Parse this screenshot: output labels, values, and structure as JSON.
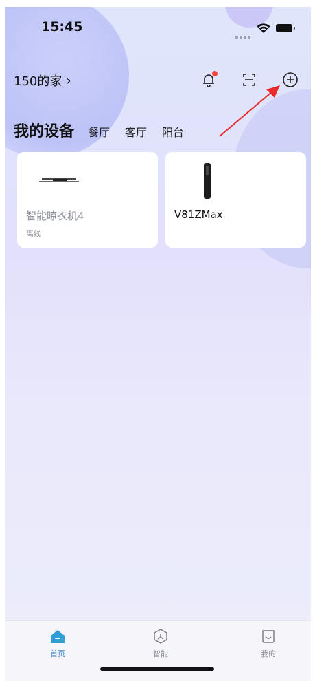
{
  "status_bar": {
    "time": "15:45"
  },
  "header": {
    "home_name": "150的家",
    "chevron": "›",
    "icons": [
      "bell-icon",
      "scan-icon",
      "plus-circle-icon"
    ]
  },
  "tabs": {
    "title": "我的设备",
    "rooms": [
      "餐厅",
      "客厅",
      "阳台"
    ]
  },
  "devices": [
    {
      "name": "智能晾衣机4",
      "status": "离线",
      "icon": "drying-rack-icon"
    },
    {
      "name": "V81ZMax",
      "status": "",
      "icon": "vacuum-icon"
    }
  ],
  "tabbar": {
    "items": [
      {
        "label": "首页",
        "icon": "home-icon"
      },
      {
        "label": "智能",
        "icon": "smart-icon"
      },
      {
        "label": "我的",
        "icon": "profile-icon"
      }
    ]
  },
  "colors": {
    "accent": "#4a8ac8",
    "alert": "#f0463c",
    "arrow": "#e82a2a"
  }
}
